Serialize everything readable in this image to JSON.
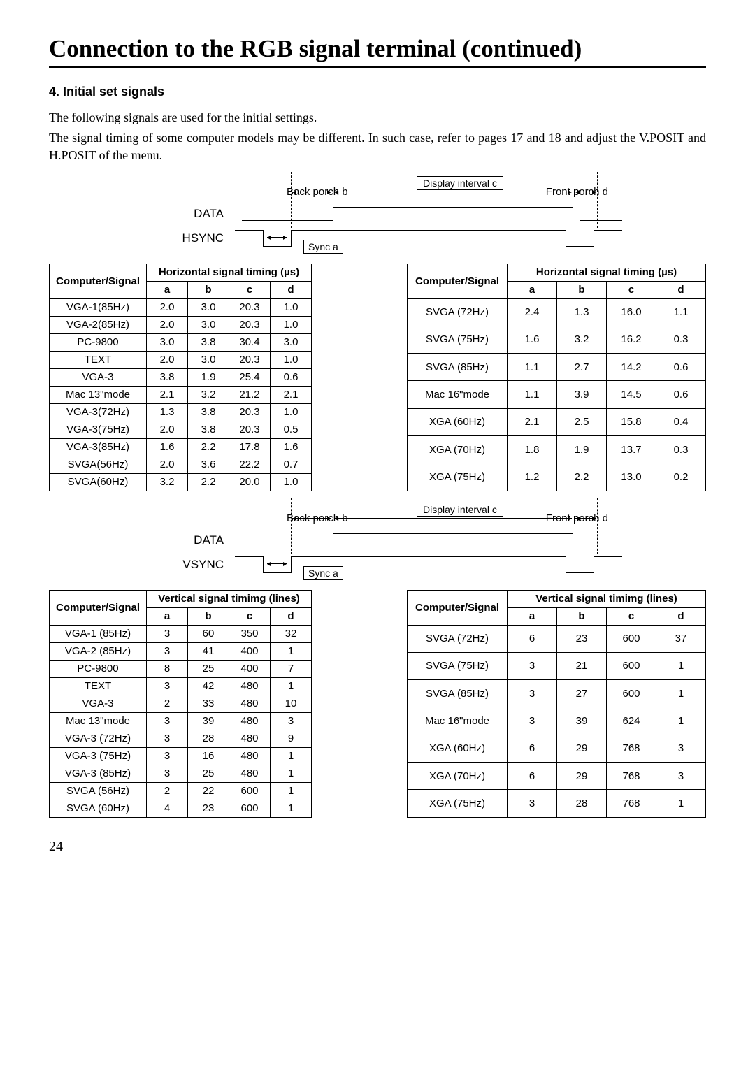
{
  "title": "Connection to the RGB signal terminal (continued)",
  "section_heading": "4.  Initial set signals",
  "paragraph1": "The following signals are used for the initial settings.",
  "paragraph2": "The signal timing of some computer models may be different. In such case, refer to pages 17 and 18 and adjust the V.POSIT and H.POSIT of the menu.",
  "diagram": {
    "back_porch": "Back porch b",
    "front_porch": "Front porch d",
    "display_interval": "Display interval c",
    "data": "DATA",
    "hsync": "HSYNC",
    "vsync": "VSYNC",
    "sync_a": "Sync a"
  },
  "horiz_header_main": "Horizontal signal timing (µs)",
  "vert_header_main": "Vertical signal timimg (lines)",
  "col_signal": "Computer/Signal",
  "cols": {
    "a": "a",
    "b": "b",
    "c": "c",
    "d": "d"
  },
  "horiz_left": [
    {
      "s": "VGA-1(85Hz)",
      "a": "2.0",
      "b": "3.0",
      "c": "20.3",
      "d": "1.0"
    },
    {
      "s": "VGA-2(85Hz)",
      "a": "2.0",
      "b": "3.0",
      "c": "20.3",
      "d": "1.0"
    },
    {
      "s": "PC-9800",
      "a": "3.0",
      "b": "3.8",
      "c": "30.4",
      "d": "3.0"
    },
    {
      "s": "TEXT",
      "a": "2.0",
      "b": "3.0",
      "c": "20.3",
      "d": "1.0"
    },
    {
      "s": "VGA-3",
      "a": "3.8",
      "b": "1.9",
      "c": "25.4",
      "d": "0.6"
    },
    {
      "s": "Mac 13\"mode",
      "a": "2.1",
      "b": "3.2",
      "c": "21.2",
      "d": "2.1"
    },
    {
      "s": "VGA-3(72Hz)",
      "a": "1.3",
      "b": "3.8",
      "c": "20.3",
      "d": "1.0"
    },
    {
      "s": "VGA-3(75Hz)",
      "a": "2.0",
      "b": "3.8",
      "c": "20.3",
      "d": "0.5"
    },
    {
      "s": "VGA-3(85Hz)",
      "a": "1.6",
      "b": "2.2",
      "c": "17.8",
      "d": "1.6"
    },
    {
      "s": "SVGA(56Hz)",
      "a": "2.0",
      "b": "3.6",
      "c": "22.2",
      "d": "0.7"
    },
    {
      "s": "SVGA(60Hz)",
      "a": "3.2",
      "b": "2.2",
      "c": "20.0",
      "d": "1.0"
    }
  ],
  "horiz_right": [
    {
      "s": "SVGA (72Hz)",
      "a": "2.4",
      "b": "1.3",
      "c": "16.0",
      "d": "1.1"
    },
    {
      "s": "SVGA (75Hz)",
      "a": "1.6",
      "b": "3.2",
      "c": "16.2",
      "d": "0.3"
    },
    {
      "s": "SVGA (85Hz)",
      "a": "1.1",
      "b": "2.7",
      "c": "14.2",
      "d": "0.6"
    },
    {
      "s": "Mac 16\"mode",
      "a": "1.1",
      "b": "3.9",
      "c": "14.5",
      "d": "0.6"
    },
    {
      "s": "XGA (60Hz)",
      "a": "2.1",
      "b": "2.5",
      "c": "15.8",
      "d": "0.4"
    },
    {
      "s": "XGA (70Hz)",
      "a": "1.8",
      "b": "1.9",
      "c": "13.7",
      "d": "0.3"
    },
    {
      "s": "XGA (75Hz)",
      "a": "1.2",
      "b": "2.2",
      "c": "13.0",
      "d": "0.2"
    }
  ],
  "vert_left": [
    {
      "s": "VGA-1 (85Hz)",
      "a": "3",
      "b": "60",
      "c": "350",
      "d": "32"
    },
    {
      "s": "VGA-2 (85Hz)",
      "a": "3",
      "b": "41",
      "c": "400",
      "d": "1"
    },
    {
      "s": "PC-9800",
      "a": "8",
      "b": "25",
      "c": "400",
      "d": "7"
    },
    {
      "s": "TEXT",
      "a": "3",
      "b": "42",
      "c": "480",
      "d": "1"
    },
    {
      "s": "VGA-3",
      "a": "2",
      "b": "33",
      "c": "480",
      "d": "10"
    },
    {
      "s": "Mac 13\"mode",
      "a": "3",
      "b": "39",
      "c": "480",
      "d": "3"
    },
    {
      "s": "VGA-3 (72Hz)",
      "a": "3",
      "b": "28",
      "c": "480",
      "d": "9"
    },
    {
      "s": "VGA-3 (75Hz)",
      "a": "3",
      "b": "16",
      "c": "480",
      "d": "1"
    },
    {
      "s": "VGA-3 (85Hz)",
      "a": "3",
      "b": "25",
      "c": "480",
      "d": "1"
    },
    {
      "s": "SVGA (56Hz)",
      "a": "2",
      "b": "22",
      "c": "600",
      "d": "1"
    },
    {
      "s": "SVGA (60Hz)",
      "a": "4",
      "b": "23",
      "c": "600",
      "d": "1"
    }
  ],
  "vert_right": [
    {
      "s": "SVGA (72Hz)",
      "a": "6",
      "b": "23",
      "c": "600",
      "d": "37"
    },
    {
      "s": "SVGA (75Hz)",
      "a": "3",
      "b": "21",
      "c": "600",
      "d": "1"
    },
    {
      "s": "SVGA (85Hz)",
      "a": "3",
      "b": "27",
      "c": "600",
      "d": "1"
    },
    {
      "s": "Mac 16\"mode",
      "a": "3",
      "b": "39",
      "c": "624",
      "d": "1"
    },
    {
      "s": "XGA (60Hz)",
      "a": "6",
      "b": "29",
      "c": "768",
      "d": "3"
    },
    {
      "s": "XGA (70Hz)",
      "a": "6",
      "b": "29",
      "c": "768",
      "d": "3"
    },
    {
      "s": "XGA (75Hz)",
      "a": "3",
      "b": "28",
      "c": "768",
      "d": "1"
    }
  ],
  "page_number": "24",
  "chart_data": [
    {
      "type": "table",
      "title": "Horizontal signal timing (µs) — left",
      "columns": [
        "Computer/Signal",
        "a",
        "b",
        "c",
        "d"
      ],
      "rows": [
        [
          "VGA-1(85Hz)",
          2.0,
          3.0,
          20.3,
          1.0
        ],
        [
          "VGA-2(85Hz)",
          2.0,
          3.0,
          20.3,
          1.0
        ],
        [
          "PC-9800",
          3.0,
          3.8,
          30.4,
          3.0
        ],
        [
          "TEXT",
          2.0,
          3.0,
          20.3,
          1.0
        ],
        [
          "VGA-3",
          3.8,
          1.9,
          25.4,
          0.6
        ],
        [
          "Mac 13\"mode",
          2.1,
          3.2,
          21.2,
          2.1
        ],
        [
          "VGA-3(72Hz)",
          1.3,
          3.8,
          20.3,
          1.0
        ],
        [
          "VGA-3(75Hz)",
          2.0,
          3.8,
          20.3,
          0.5
        ],
        [
          "VGA-3(85Hz)",
          1.6,
          2.2,
          17.8,
          1.6
        ],
        [
          "SVGA(56Hz)",
          2.0,
          3.6,
          22.2,
          0.7
        ],
        [
          "SVGA(60Hz)",
          3.2,
          2.2,
          20.0,
          1.0
        ]
      ]
    },
    {
      "type": "table",
      "title": "Horizontal signal timing (µs) — right",
      "columns": [
        "Computer/Signal",
        "a",
        "b",
        "c",
        "d"
      ],
      "rows": [
        [
          "SVGA (72Hz)",
          2.4,
          1.3,
          16.0,
          1.1
        ],
        [
          "SVGA (75Hz)",
          1.6,
          3.2,
          16.2,
          0.3
        ],
        [
          "SVGA (85Hz)",
          1.1,
          2.7,
          14.2,
          0.6
        ],
        [
          "Mac 16\"mode",
          1.1,
          3.9,
          14.5,
          0.6
        ],
        [
          "XGA (60Hz)",
          2.1,
          2.5,
          15.8,
          0.4
        ],
        [
          "XGA (70Hz)",
          1.8,
          1.9,
          13.7,
          0.3
        ],
        [
          "XGA (75Hz)",
          1.2,
          2.2,
          13.0,
          0.2
        ]
      ]
    },
    {
      "type": "table",
      "title": "Vertical signal timimg (lines) — left",
      "columns": [
        "Computer/Signal",
        "a",
        "b",
        "c",
        "d"
      ],
      "rows": [
        [
          "VGA-1 (85Hz)",
          3,
          60,
          350,
          32
        ],
        [
          "VGA-2 (85Hz)",
          3,
          41,
          400,
          1
        ],
        [
          "PC-9800",
          8,
          25,
          400,
          7
        ],
        [
          "TEXT",
          3,
          42,
          480,
          1
        ],
        [
          "VGA-3",
          2,
          33,
          480,
          10
        ],
        [
          "Mac 13\"mode",
          3,
          39,
          480,
          3
        ],
        [
          "VGA-3 (72Hz)",
          3,
          28,
          480,
          9
        ],
        [
          "VGA-3 (75Hz)",
          3,
          16,
          480,
          1
        ],
        [
          "VGA-3 (85Hz)",
          3,
          25,
          480,
          1
        ],
        [
          "SVGA (56Hz)",
          2,
          22,
          600,
          1
        ],
        [
          "SVGA (60Hz)",
          4,
          23,
          600,
          1
        ]
      ]
    },
    {
      "type": "table",
      "title": "Vertical signal timimg (lines) — right",
      "columns": [
        "Computer/Signal",
        "a",
        "b",
        "c",
        "d"
      ],
      "rows": [
        [
          "SVGA (72Hz)",
          6,
          23,
          600,
          37
        ],
        [
          "SVGA (75Hz)",
          3,
          21,
          600,
          1
        ],
        [
          "SVGA (85Hz)",
          3,
          27,
          600,
          1
        ],
        [
          "Mac 16\"mode",
          3,
          39,
          624,
          1
        ],
        [
          "XGA (60Hz)",
          6,
          29,
          768,
          3
        ],
        [
          "XGA (70Hz)",
          6,
          29,
          768,
          3
        ],
        [
          "XGA (75Hz)",
          3,
          28,
          768,
          1
        ]
      ]
    }
  ]
}
